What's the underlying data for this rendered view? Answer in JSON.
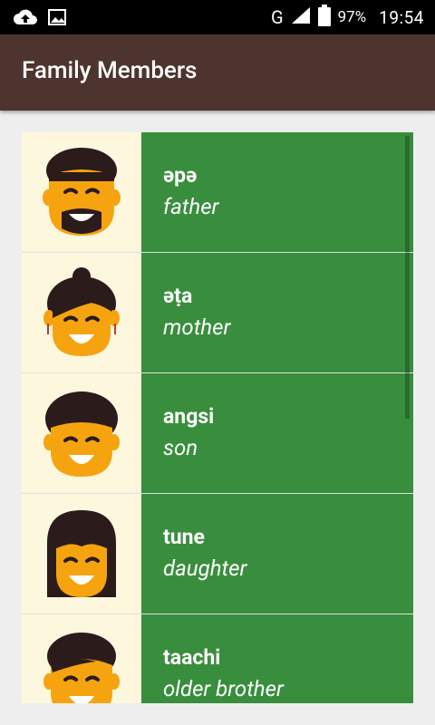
{
  "status_bar": {
    "icons": [
      "cloud-upload-icon",
      "image-icon",
      "network-g-icon",
      "signal-icon",
      "battery-icon"
    ],
    "network_label": "G",
    "battery": "97%",
    "time": "19:54"
  },
  "app_bar": {
    "title": "Family Members",
    "color": "#4e342e"
  },
  "colors": {
    "avatar_bg": "#fdf7de",
    "card_bg": "#388e3c",
    "skin": "#f5a40f",
    "hair": "#2b1b1b"
  },
  "items": [
    {
      "word": "əpə",
      "translation": "father",
      "icon": "father-face-icon"
    },
    {
      "word": "əṭa",
      "translation": "mother",
      "icon": "mother-face-icon"
    },
    {
      "word": "angsi",
      "translation": "son",
      "icon": "son-face-icon"
    },
    {
      "word": "tune",
      "translation": "daughter",
      "icon": "daughter-face-icon"
    },
    {
      "word": "taachi",
      "translation": "older brother",
      "icon": "older-brother-face-icon"
    }
  ]
}
